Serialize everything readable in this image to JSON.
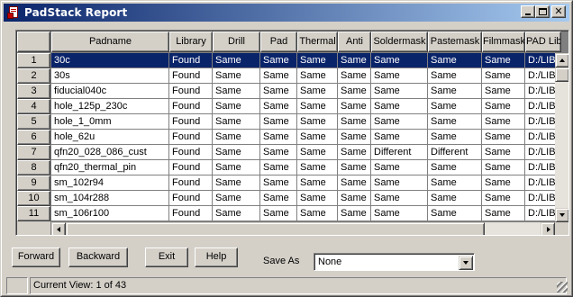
{
  "window": {
    "title": "PadStack Report"
  },
  "grid": {
    "columns": [
      "Padname",
      "Library",
      "Drill",
      "Pad",
      "Thermal",
      "Anti",
      "Soldermask",
      "Pastemask",
      "Filmmask",
      "PAD Lib"
    ],
    "rows": [
      {
        "num": "1",
        "cells": [
          "30c",
          "Found",
          "Same",
          "Same",
          "Same",
          "Same",
          "Same",
          "Same",
          "Same",
          "D:/LIB"
        ],
        "selected": true
      },
      {
        "num": "2",
        "cells": [
          "30s",
          "Found",
          "Same",
          "Same",
          "Same",
          "Same",
          "Same",
          "Same",
          "Same",
          "D:/LIB"
        ]
      },
      {
        "num": "3",
        "cells": [
          "fiducial040c",
          "Found",
          "Same",
          "Same",
          "Same",
          "Same",
          "Same",
          "Same",
          "Same",
          "D:/LIB"
        ]
      },
      {
        "num": "4",
        "cells": [
          "hole_125p_230c",
          "Found",
          "Same",
          "Same",
          "Same",
          "Same",
          "Same",
          "Same",
          "Same",
          "D:/LIB"
        ]
      },
      {
        "num": "5",
        "cells": [
          "hole_1_0mm",
          "Found",
          "Same",
          "Same",
          "Same",
          "Same",
          "Same",
          "Same",
          "Same",
          "D:/LIB"
        ]
      },
      {
        "num": "6",
        "cells": [
          "hole_62u",
          "Found",
          "Same",
          "Same",
          "Same",
          "Same",
          "Same",
          "Same",
          "Same",
          "D:/LIB"
        ]
      },
      {
        "num": "7",
        "cells": [
          "qfn20_028_086_cust",
          "Found",
          "Same",
          "Same",
          "Same",
          "Same",
          "Different",
          "Different",
          "Same",
          "D:/LIB"
        ]
      },
      {
        "num": "8",
        "cells": [
          "qfn20_thermal_pin",
          "Found",
          "Same",
          "Same",
          "Same",
          "Same",
          "Same",
          "Same",
          "Same",
          "D:/LIB"
        ]
      },
      {
        "num": "9",
        "cells": [
          "sm_102r94",
          "Found",
          "Same",
          "Same",
          "Same",
          "Same",
          "Same",
          "Same",
          "Same",
          "D:/LIB"
        ]
      },
      {
        "num": "10",
        "cells": [
          "sm_104r288",
          "Found",
          "Same",
          "Same",
          "Same",
          "Same",
          "Same",
          "Same",
          "Same",
          "D:/LIB"
        ]
      },
      {
        "num": "11",
        "cells": [
          "sm_106r100",
          "Found",
          "Same",
          "Same",
          "Same",
          "Same",
          "Same",
          "Same",
          "Same",
          "D:/LIB"
        ]
      }
    ]
  },
  "buttons": {
    "forward": "Forward",
    "backward": "Backward",
    "exit": "Exit",
    "help": "Help"
  },
  "save_as": {
    "label": "Save As",
    "value": "None"
  },
  "status": {
    "text": "Current View: 1 of 43"
  },
  "colors": {
    "selection": "#0a246a",
    "face": "#d4d0c8",
    "title_gradient_start": "#0a246a",
    "title_gradient_end": "#a6caf0"
  }
}
